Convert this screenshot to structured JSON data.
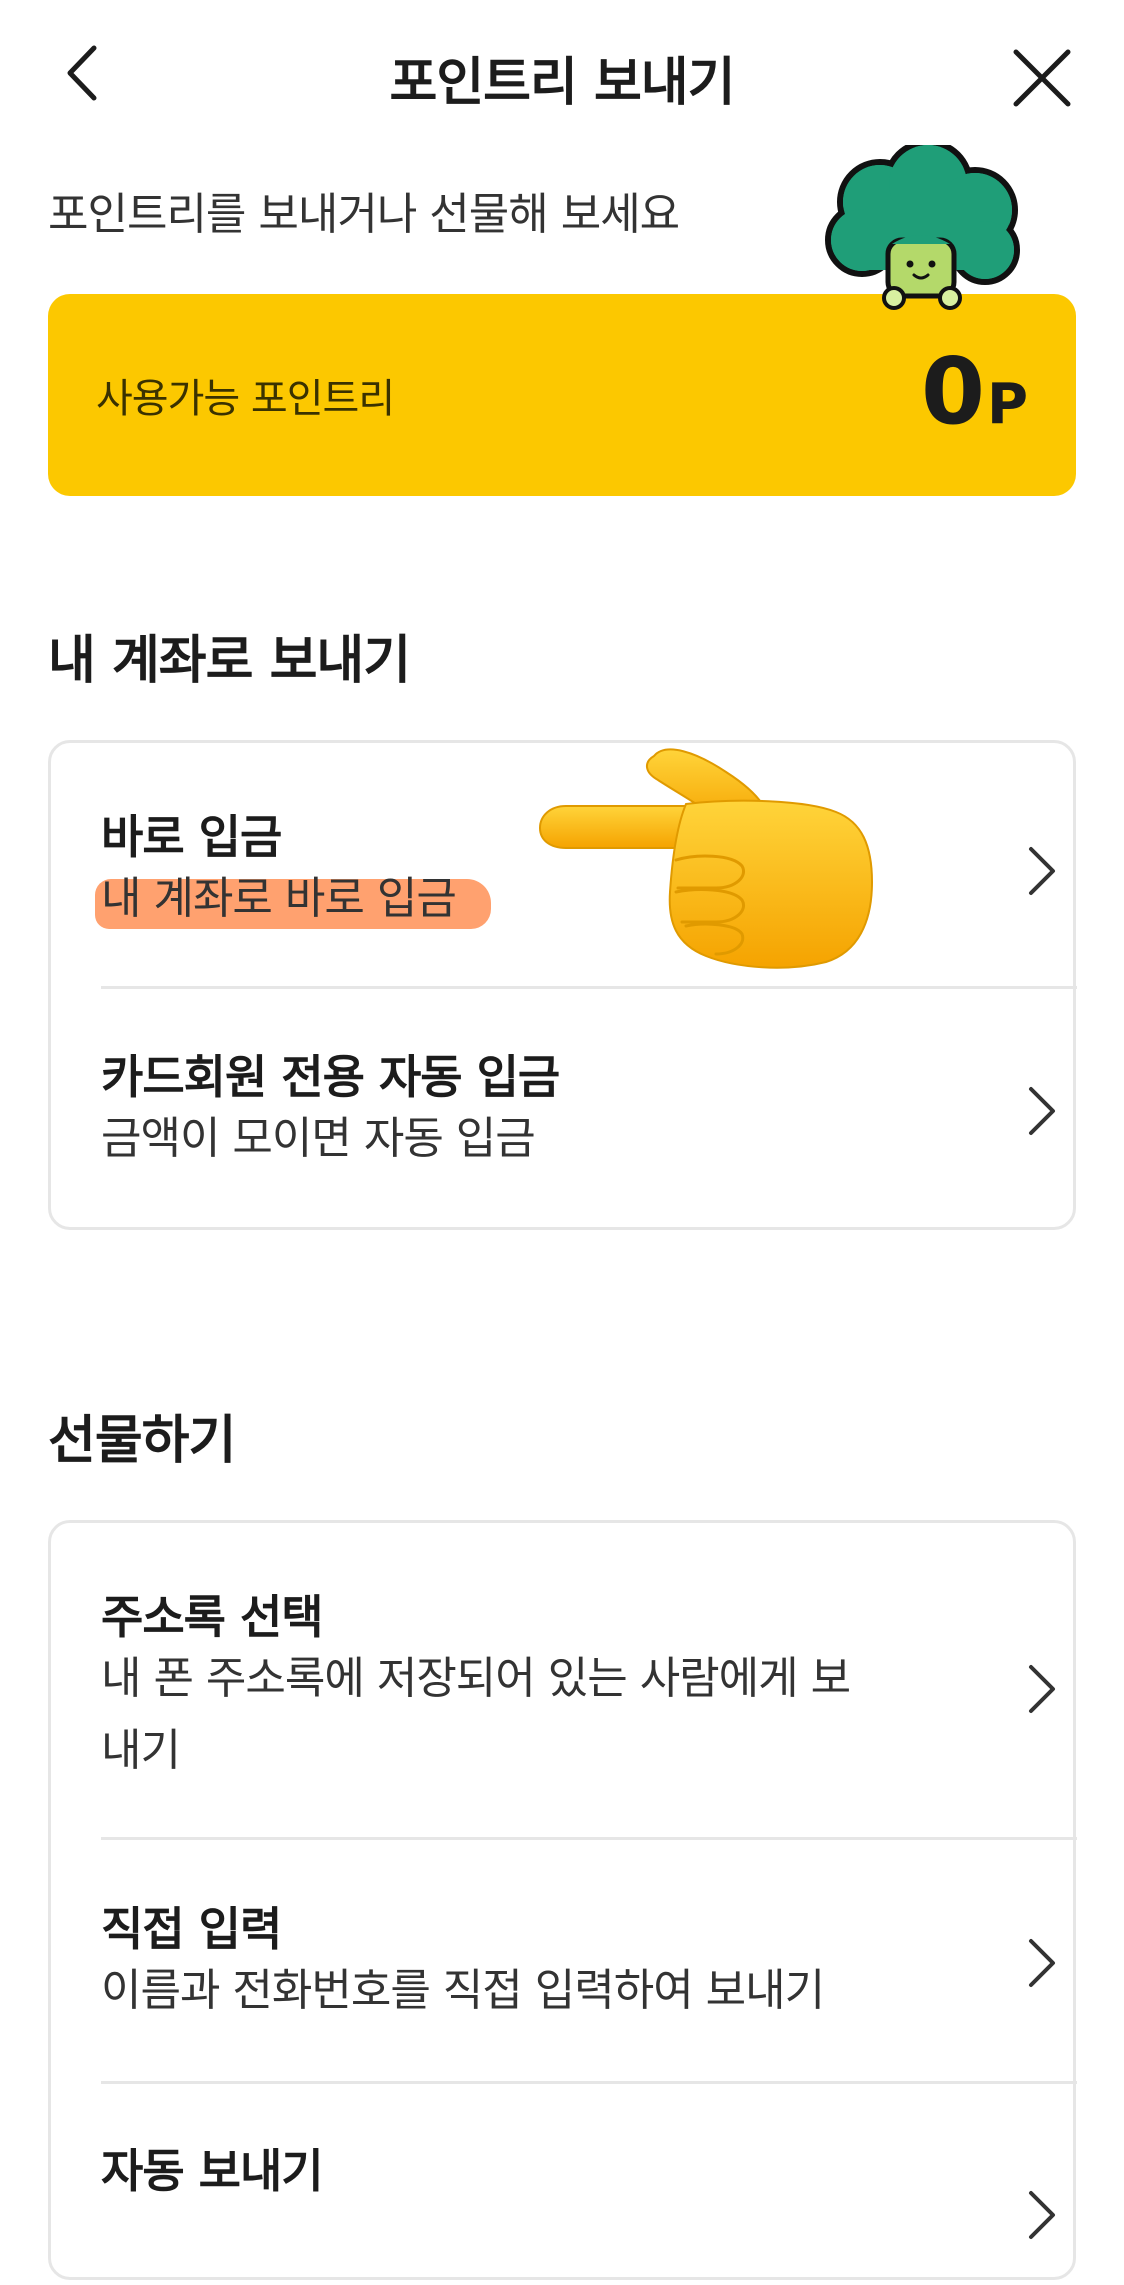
{
  "header": {
    "title": "포인트리 보내기",
    "back_icon": "chevron-left-icon",
    "close_icon": "close-icon"
  },
  "intro": {
    "subtitle": "포인트리를 보내거나 선물해 보세요",
    "mascot_icon": "broccoli-mascot-icon"
  },
  "points": {
    "label": "사용가능 포인트리",
    "value": "0",
    "unit": "P",
    "background": "#fcc800"
  },
  "my_account": {
    "title": "내 계좌로 보내기",
    "items": [
      {
        "title": "바로 입금",
        "description": "내 계좌로 바로 입금"
      },
      {
        "title": "카드회원 전용 자동 입금",
        "description": "금액이 모이면 자동 입금"
      }
    ]
  },
  "gift": {
    "title": "선물하기",
    "items": [
      {
        "title": "주소록 선택",
        "description": "내 폰 주소록에 저장되어 있는 사람에게 보내기"
      },
      {
        "title": "직접 입력",
        "description": "이름과 전화번호를 직접 입력하여 보내기"
      },
      {
        "title": "자동 보내기",
        "description": ""
      }
    ]
  },
  "annotation": {
    "pointer_icon": "pointing-hand-icon",
    "highlight_color": "#ff9156"
  }
}
